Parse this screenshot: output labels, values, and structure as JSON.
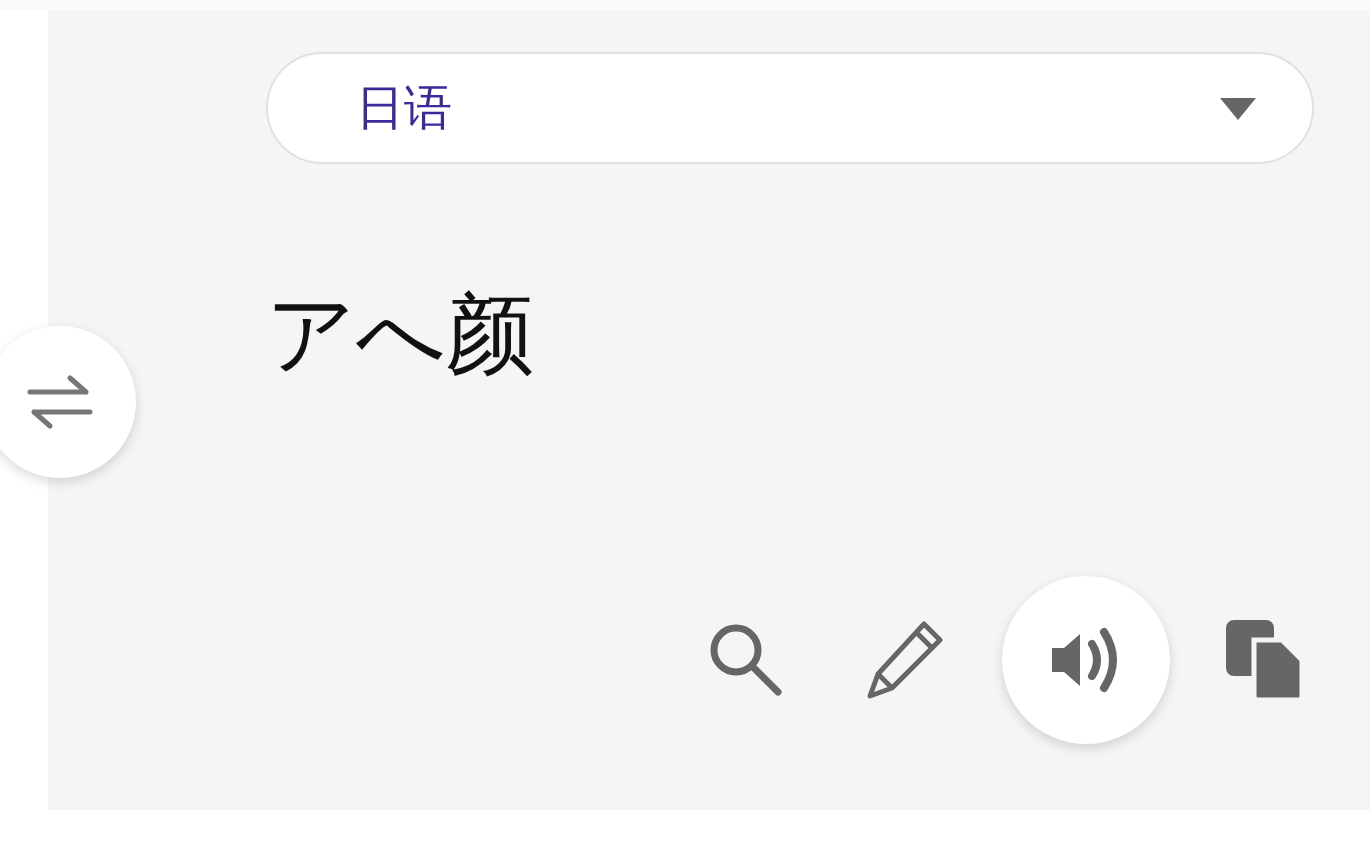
{
  "language_select": {
    "value": "日语"
  },
  "source_text": "アへ颜",
  "actions": [
    {
      "kind": "search",
      "active": false
    },
    {
      "kind": "edit",
      "active": false
    },
    {
      "kind": "speak",
      "active": true
    },
    {
      "kind": "copy",
      "active": false
    }
  ]
}
